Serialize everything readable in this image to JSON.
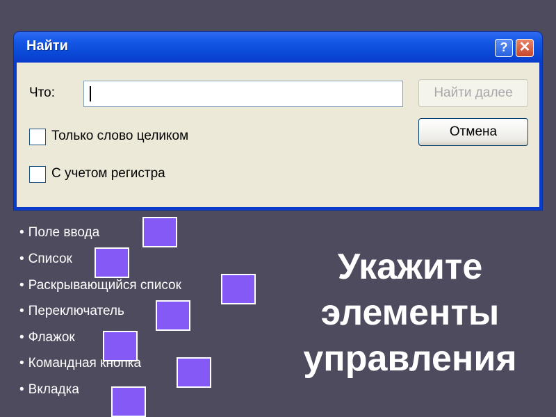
{
  "dialog": {
    "title": "Найти",
    "help_glyph": "?",
    "close_glyph": "✕",
    "find_label": "Что:",
    "find_value": "",
    "find_next_button": "Найти далее",
    "cancel_button": "Отмена",
    "checkboxes": [
      {
        "label": "Только слово целиком",
        "checked": false
      },
      {
        "label": "С учетом регистра",
        "checked": false
      }
    ]
  },
  "bullet_glyph": "•",
  "items": [
    "Поле ввода",
    "Список",
    "Раскрывающийся список",
    "Переключатель",
    "Флажок",
    "Командная кнопка",
    "Вкладка"
  ],
  "prompt_lines": [
    "Укажите",
    "элементы",
    "управления"
  ],
  "colors": {
    "background": "#4d4b5d",
    "titlebar": "#0a49d6",
    "dialog_face": "#ece9d8",
    "marker": "#8559f5"
  }
}
